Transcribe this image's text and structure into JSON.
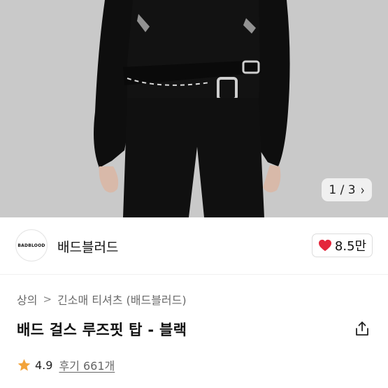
{
  "gallery": {
    "counter_text": "1 / 3",
    "next_icon": "chevron-right-icon"
  },
  "brand": {
    "logo_text": "BADBLOOD",
    "name": "배드블러드",
    "like_count": "8.5만",
    "like_icon": "heart-icon",
    "like_color": "#e4263b"
  },
  "breadcrumb": {
    "items": [
      "상의",
      "긴소매 티셔츠 (배드블러드)"
    ],
    "separator": ">"
  },
  "product": {
    "title": "배드 걸스 루즈핏 탑 - 블랙",
    "share_icon": "share-icon"
  },
  "rating": {
    "score": "4.9",
    "reviews": "후기 661개",
    "star_color": "#f2a33a"
  }
}
